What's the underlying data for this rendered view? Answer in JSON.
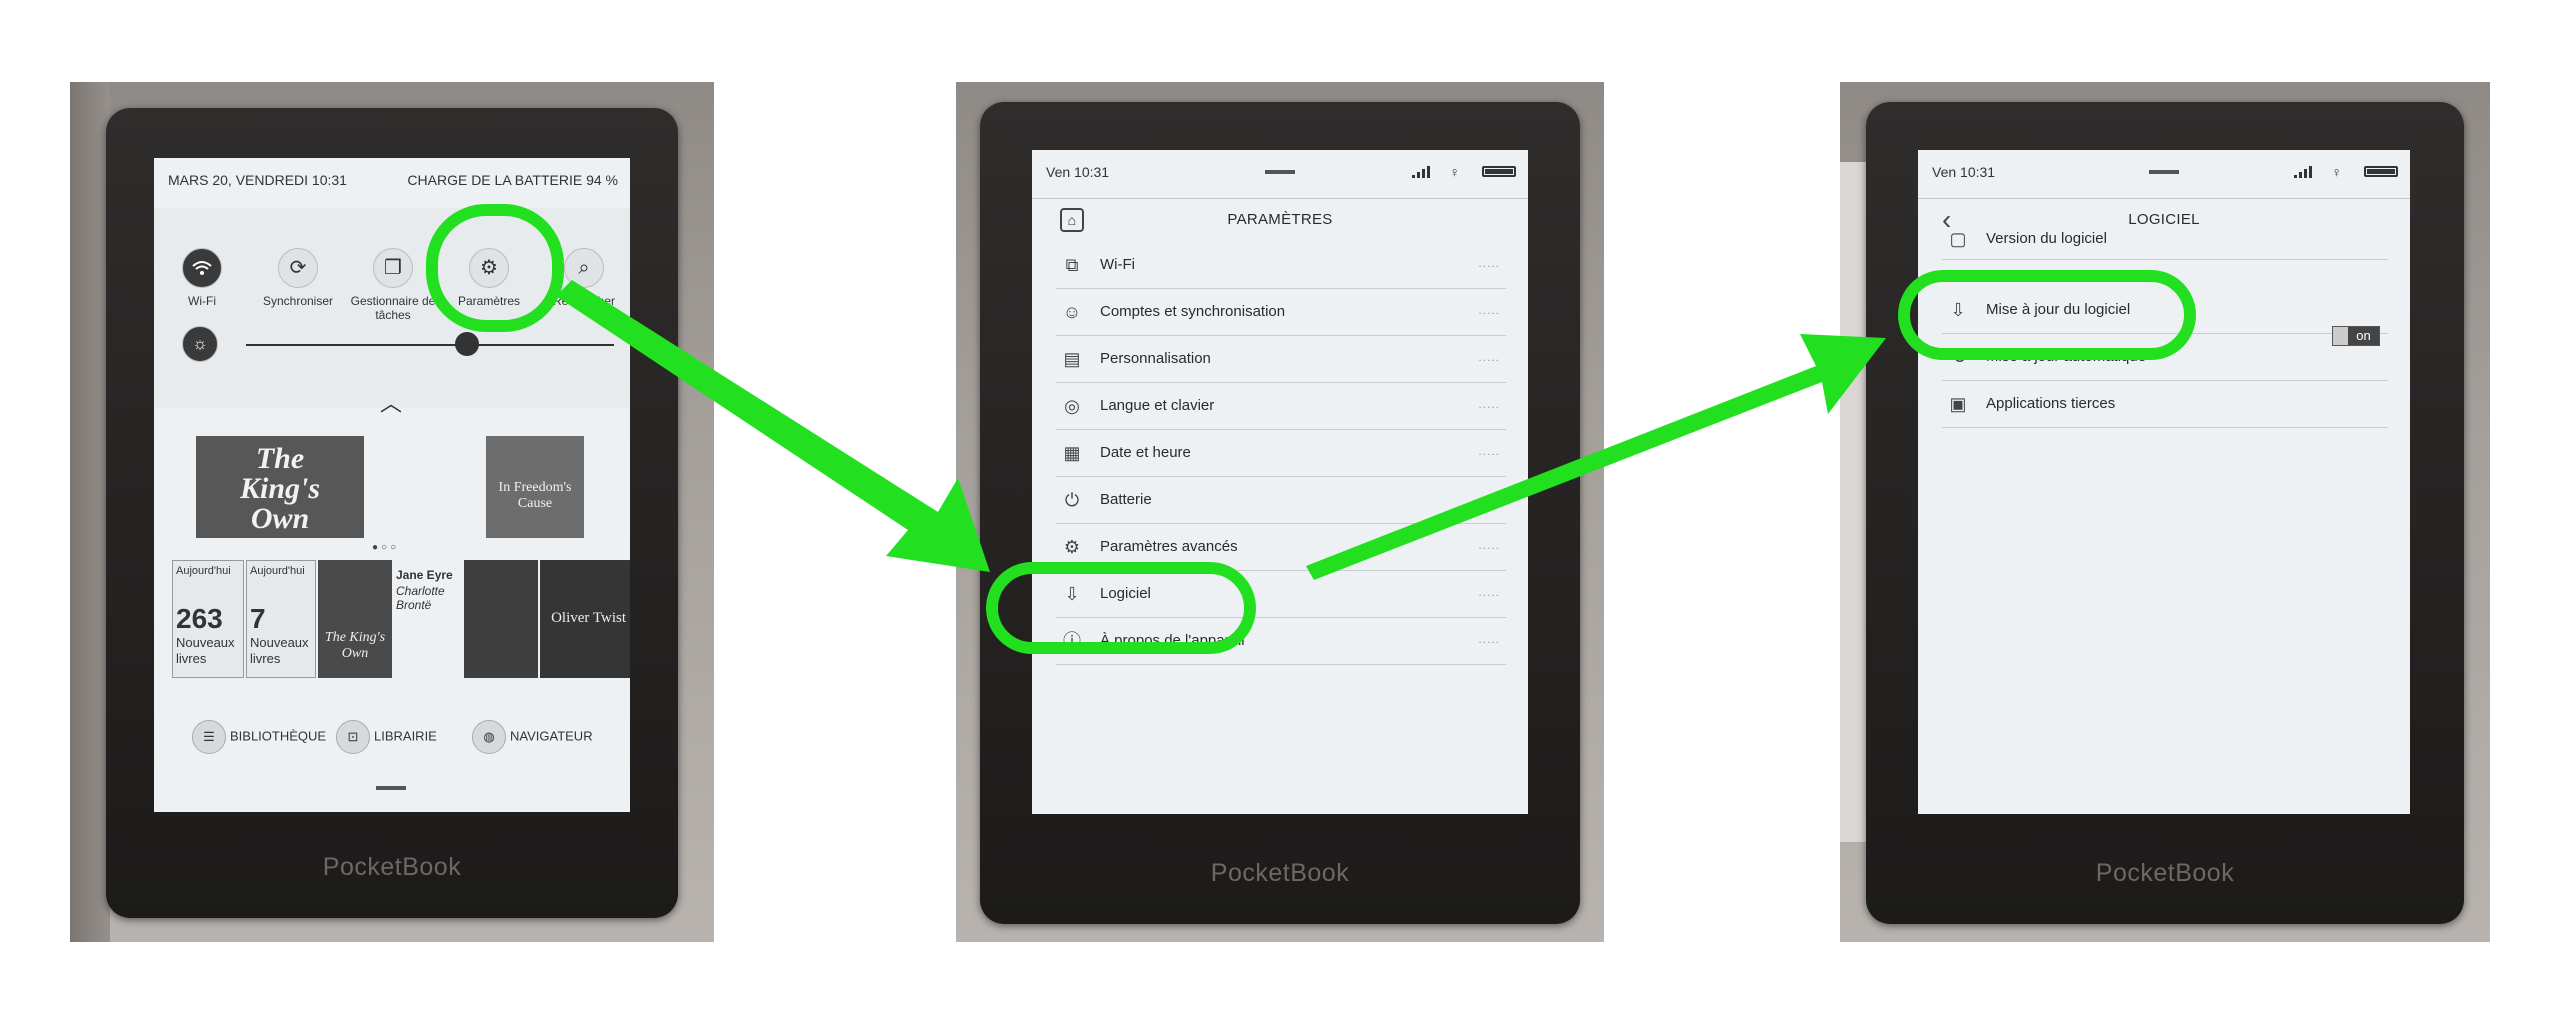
{
  "brand": "PocketBook",
  "colors": {
    "highlight": "#22e01f",
    "arrow": "#22e01f"
  },
  "panel1": {
    "status_left": "MARS 20, VENDREDI 10:31",
    "status_right": "CHARGE DE LA BATTERIE 94 %",
    "quick_actions": [
      {
        "label": "Wi-Fi",
        "icon": "wifi-icon"
      },
      {
        "label": "Synchroniser",
        "icon": "sync-icon"
      },
      {
        "label": "Gestionnaire de tâches",
        "icon": "task-manager-icon"
      },
      {
        "label": "Paramètres",
        "icon": "gear-icon"
      },
      {
        "label": "Rechercher",
        "icon": "search-icon"
      }
    ],
    "brightness_level": 0.6,
    "covers": {
      "kings_own": "The King's Own",
      "freedom": "In Freedom's Cause"
    },
    "tiles": [
      {
        "header": "Aujourd'hui",
        "count": "263",
        "caption": "Nouveaux livres"
      },
      {
        "header": "Aujourd'hui",
        "count": "7",
        "caption": "Nouveaux livres"
      }
    ],
    "jane_eyre": {
      "title": "Jane Eyre",
      "author": "Charlotte Brontë"
    },
    "oliver": "Oliver Twist",
    "nav": [
      "BIBLIOTHÈQUE",
      "LIBRAIRIE",
      "NAVIGATEUR"
    ]
  },
  "panel2": {
    "time": "Ven 10:31",
    "title": "PARAMÈTRES",
    "items": [
      {
        "label": "Wi-Fi",
        "icon": "network-icon"
      },
      {
        "label": "Comptes et synchronisation",
        "icon": "account-icon"
      },
      {
        "label": "Personnalisation",
        "icon": "customize-icon"
      },
      {
        "label": "Langue et clavier",
        "icon": "language-icon"
      },
      {
        "label": "Date et heure",
        "icon": "calendar-icon"
      },
      {
        "label": "Batterie",
        "icon": "power-icon"
      },
      {
        "label": "Paramètres avancés",
        "icon": "advanced-gear-icon"
      },
      {
        "label": "Logiciel",
        "icon": "software-icon"
      },
      {
        "label": "À propos de l'appareil",
        "icon": "info-icon"
      }
    ],
    "more": "....."
  },
  "panel3": {
    "time": "Ven 10:31",
    "title": "LOGICIEL",
    "items": [
      {
        "label": "Version du logiciel",
        "icon": "version-icon"
      },
      {
        "label": "Mise à jour du logiciel",
        "icon": "update-icon"
      },
      {
        "label": "Mise à jour automatique",
        "icon": "auto-update-icon"
      },
      {
        "label": "Applications tierces",
        "icon": "apps-icon"
      }
    ],
    "toggle_value": "on"
  }
}
